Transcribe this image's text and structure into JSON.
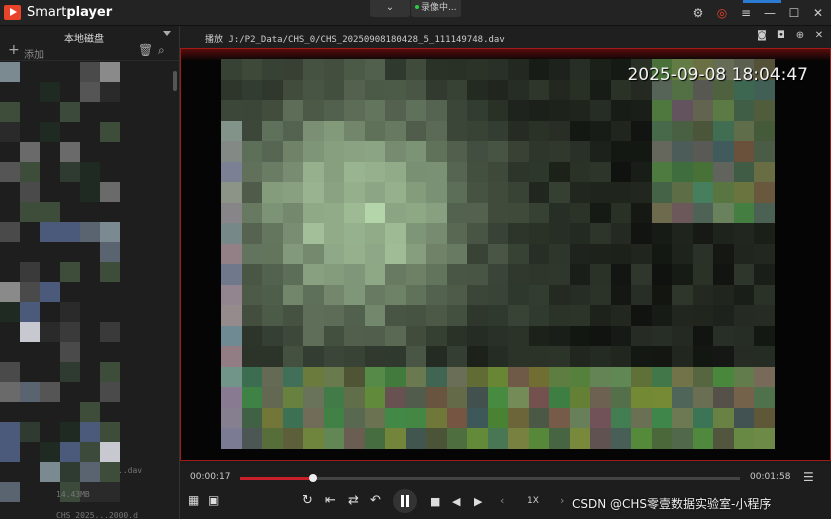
{
  "titlebar": {
    "app_name_plain": "Smart",
    "app_name_bold": "player",
    "dropdown_glyph": "⌄",
    "record_label": "录像中...",
    "record_dot_color": "#2ecc40",
    "icons": [
      "gear-icon",
      "skin-icon",
      "menu-icon",
      "minimize-icon",
      "maximize-icon",
      "close-icon"
    ]
  },
  "sidebar": {
    "source_label": "本地磁盘",
    "add_label": "添加",
    "items": [
      {
        "name": "f",
        "text": "..dav"
      },
      {
        "name": "size",
        "text": "14.43MB"
      },
      {
        "name": "last",
        "text": "CHS_2025...2000.d"
      }
    ]
  },
  "player": {
    "path_text": "播放 J:/P2_Data/CHS_0/CHS_20250908180428_5_111149748.dav",
    "timestamp": "2025-09-08 18:04:47",
    "time_elapsed": "00:00:17",
    "time_total": "00:01:58",
    "progress": 0.145,
    "speed": "1X",
    "accent_color": "#c9202a"
  },
  "watermark": "CSDN @CHS零壹数据实验室-小程序"
}
